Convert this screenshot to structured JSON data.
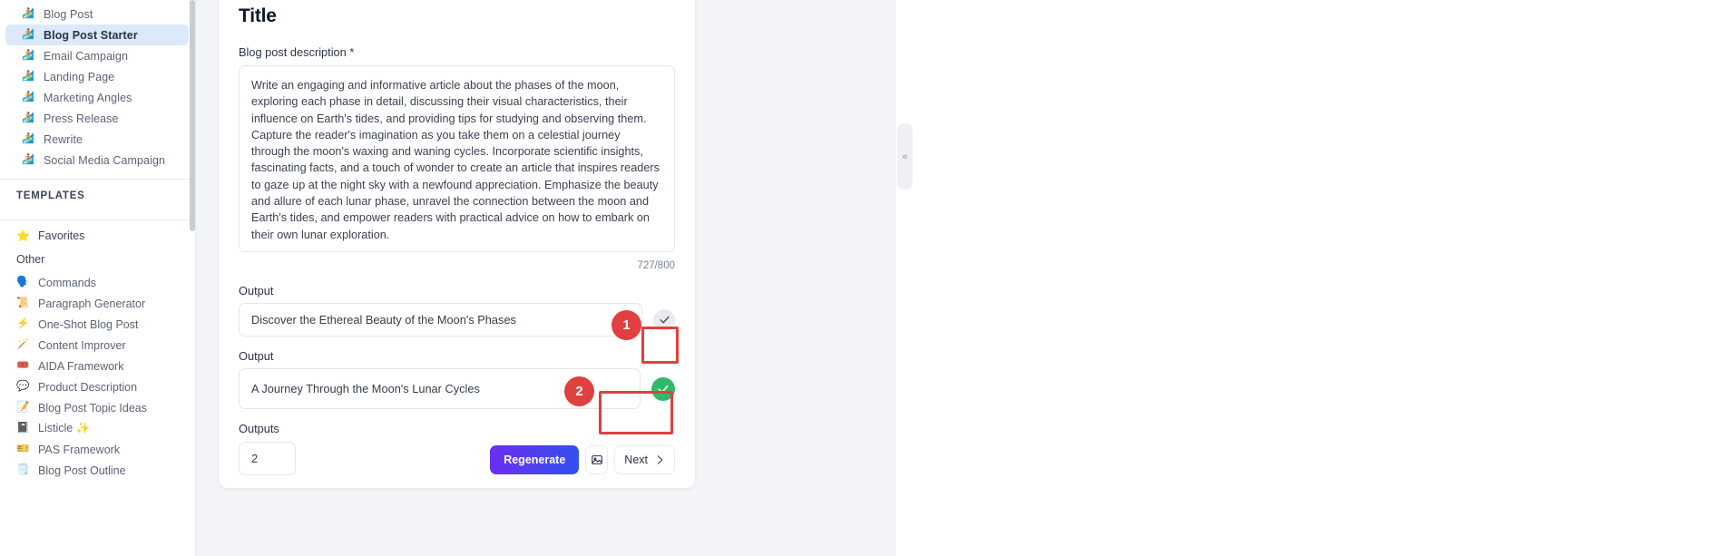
{
  "sidebar": {
    "nav_items": [
      {
        "icon": "surfer-icon",
        "emoji": "🏄",
        "label": "Blog Post",
        "active": false
      },
      {
        "icon": "surfer-icon",
        "emoji": "🏄",
        "label": "Blog Post Starter",
        "active": true
      },
      {
        "icon": "surfer-icon",
        "emoji": "🏄",
        "label": "Email Campaign",
        "active": false
      },
      {
        "icon": "surfer-icon",
        "emoji": "🏄",
        "label": "Landing Page",
        "active": false
      },
      {
        "icon": "surfer-icon",
        "emoji": "🏄",
        "label": "Marketing Angles",
        "active": false
      },
      {
        "icon": "surfer-icon",
        "emoji": "🏄",
        "label": "Press Release",
        "active": false
      },
      {
        "icon": "surfer-icon",
        "emoji": "🏄",
        "label": "Rewrite",
        "active": false
      },
      {
        "icon": "surfer-icon",
        "emoji": "🏄",
        "label": "Social Media Campaign",
        "active": false
      }
    ],
    "templates_heading": "TEMPLATES",
    "favorites": {
      "icon": "star-icon",
      "emoji": "⭐",
      "label": "Favorites"
    },
    "group_label": "Other",
    "template_items": [
      {
        "icon": "speaking-head-icon",
        "emoji": "🗣️",
        "label": "Commands"
      },
      {
        "icon": "scroll-icon",
        "emoji": "📜",
        "label": "Paragraph Generator"
      },
      {
        "icon": "lightning-icon",
        "emoji": "⚡",
        "label": "One-Shot Blog Post"
      },
      {
        "icon": "magic-wand-icon",
        "emoji": "🪄",
        "label": "Content Improver"
      },
      {
        "icon": "aida-icon",
        "emoji": "🎟️",
        "label": "AIDA Framework"
      },
      {
        "icon": "speech-balloon-icon",
        "emoji": "💬",
        "label": "Product Description"
      },
      {
        "icon": "note-icon",
        "emoji": "📝",
        "label": "Blog Post Topic Ideas"
      },
      {
        "icon": "book-icon",
        "emoji": "📓",
        "label": "Listicle ✨"
      },
      {
        "icon": "pas-icon",
        "emoji": "🎫",
        "label": "PAS Framework"
      },
      {
        "icon": "outline-icon",
        "emoji": "🗒️",
        "label": "Blog Post Outline"
      }
    ]
  },
  "main": {
    "page_title": "Title",
    "description_label": "Blog post description *",
    "description_value": "Write an engaging and informative article about the phases of the moon, exploring each phase in detail, discussing their visual characteristics, their influence on Earth's tides, and providing tips for studying and observing them. Capture the reader's imagination as you take them on a celestial journey through the moon's waxing and waning cycles. Incorporate scientific insights, fascinating facts, and a touch of wonder to create an article that inspires readers to gaze up at the night sky with a newfound appreciation. Emphasize the beauty and allure of each lunar phase, unravel the connection between the moon and Earth's tides, and empower readers with practical advice on how to embark on their own lunar exploration.",
    "char_count": "727/800",
    "outputs": [
      {
        "label": "Output",
        "value": "Discover the Ethereal Beauty of the Moon's Phases",
        "check_state": "inactive"
      },
      {
        "label": "Output",
        "value": "A Journey Through the Moon's Lunar Cycles",
        "check_state": "selected"
      }
    ],
    "outputs_count_label": "Outputs",
    "outputs_count_value": "2",
    "buttons": {
      "regenerate": "Regenerate",
      "image_icon": "image-icon",
      "next": "Next"
    },
    "collapse_handle": "«"
  },
  "annotations": [
    {
      "number": "1",
      "target": "selected-output-check-button"
    },
    {
      "number": "2",
      "target": "next-button"
    }
  ],
  "colors": {
    "accent_purple": "#6d2df0",
    "accent_blue": "#3150ef",
    "success_green": "#30b96a",
    "annotation_red": "#e0403f",
    "active_nav_bg": "#dce9fb"
  }
}
